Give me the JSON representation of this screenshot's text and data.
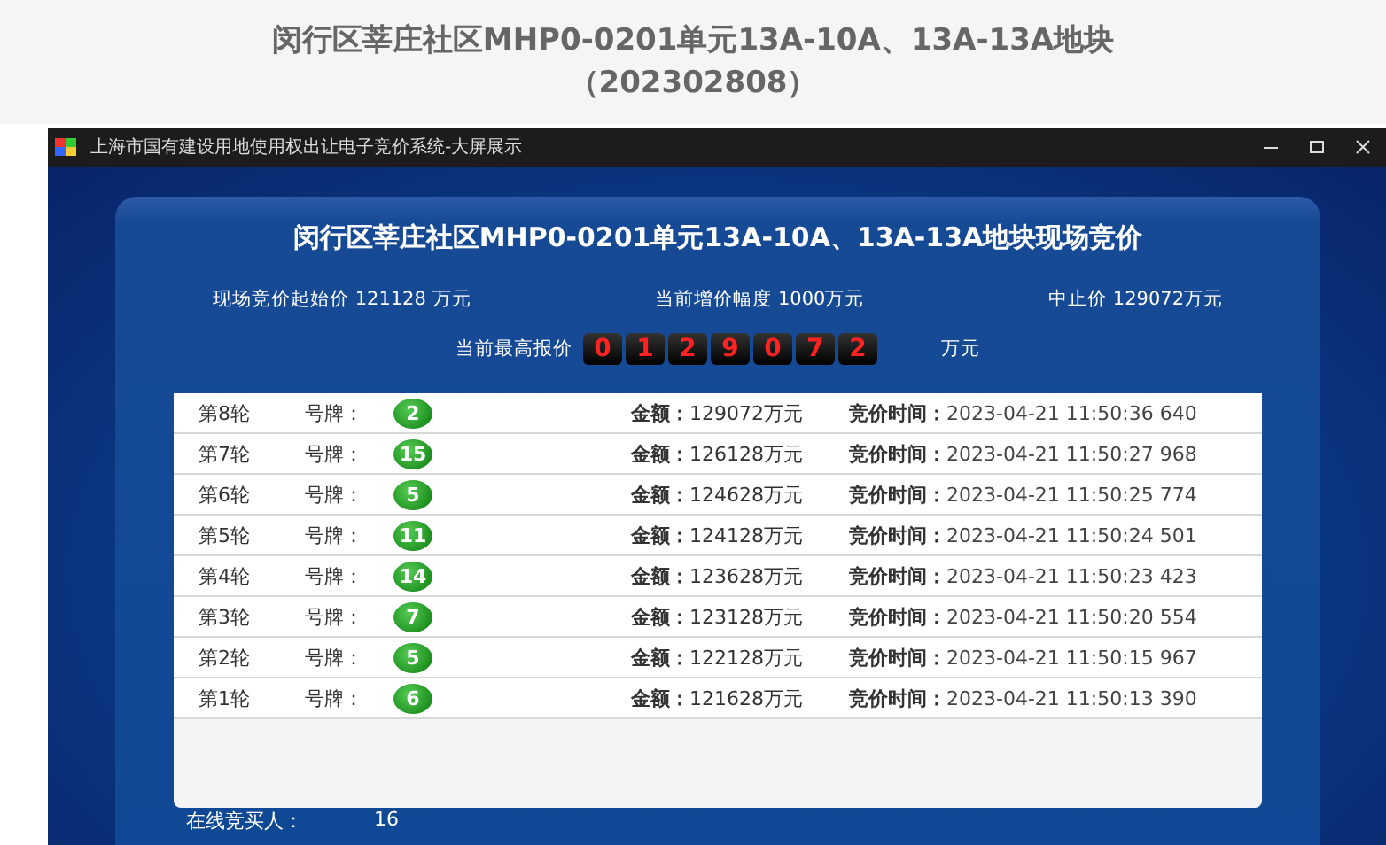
{
  "page_heading": {
    "line_1": "闵行区莘庄社区MHP0-0201单元13A-10A、13A-13A地块",
    "line_2": "（202302808）"
  },
  "window": {
    "title": "上海市国有建设用地使用权出让电子竞价系统-大屏展示"
  },
  "panel": {
    "title": "闵行区莘庄社区MHP0-0201单元13A-10A、13A-13A地块现场竞价",
    "info": [
      {
        "label": "现场竞价起始价",
        "value": "121128 万元"
      },
      {
        "label": "当前增价幅度",
        "value": "1000万元"
      },
      {
        "label": "中止价",
        "value": "129072万元"
      }
    ],
    "highest_bid": {
      "label": "当前最高报价",
      "digits": [
        "0",
        "1",
        "2",
        "9",
        "0",
        "7",
        "2"
      ],
      "unit": "万元"
    }
  },
  "bids": [
    {
      "round": "第8轮",
      "plate_label": "号牌：",
      "plate": "2",
      "amount_label": "金额：",
      "amount": "129072万元",
      "time_label": "竞价时间：",
      "time": "2023-04-21 11:50:36 640"
    },
    {
      "round": "第7轮",
      "plate_label": "号牌：",
      "plate": "15",
      "amount_label": "金额：",
      "amount": "126128万元",
      "time_label": "竞价时间：",
      "time": "2023-04-21 11:50:27 968"
    },
    {
      "round": "第6轮",
      "plate_label": "号牌：",
      "plate": "5",
      "amount_label": "金额：",
      "amount": "124628万元",
      "time_label": "竞价时间：",
      "time": "2023-04-21 11:50:25 774"
    },
    {
      "round": "第5轮",
      "plate_label": "号牌：",
      "plate": "11",
      "amount_label": "金额：",
      "amount": "124128万元",
      "time_label": "竞价时间：",
      "time": "2023-04-21 11:50:24 501"
    },
    {
      "round": "第4轮",
      "plate_label": "号牌：",
      "plate": "14",
      "amount_label": "金额：",
      "amount": "123628万元",
      "time_label": "竞价时间：",
      "time": "2023-04-21 11:50:23 423"
    },
    {
      "round": "第3轮",
      "plate_label": "号牌：",
      "plate": "7",
      "amount_label": "金额：",
      "amount": "123128万元",
      "time_label": "竞价时间：",
      "time": "2023-04-21 11:50:20 554"
    },
    {
      "round": "第2轮",
      "plate_label": "号牌：",
      "plate": "5",
      "amount_label": "金额：",
      "amount": "122128万元",
      "time_label": "竞价时间：",
      "time": "2023-04-21 11:50:15 967"
    },
    {
      "round": "第1轮",
      "plate_label": "号牌：",
      "plate": "6",
      "amount_label": "金额：",
      "amount": "121628万元",
      "time_label": "竞价时间：",
      "time": "2023-04-21 11:50:13 390"
    }
  ],
  "online_bidders": {
    "label": "在线竞买人：",
    "value": "16"
  }
}
